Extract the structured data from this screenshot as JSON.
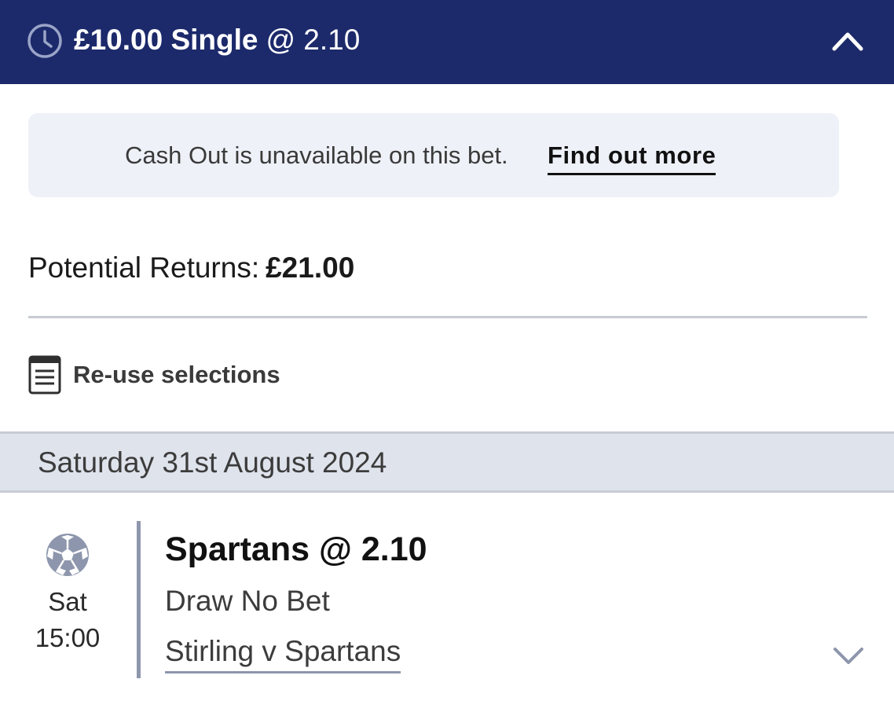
{
  "header": {
    "stake_label": "£10.00 Single",
    "odds_label": "@ 2.10",
    "icon": "clock-icon",
    "collapse_icon": "chevron-up-icon",
    "background_color": "#1c2a6b"
  },
  "cash_out_notice": {
    "message": "Cash Out is unavailable on this bet.",
    "link_label": "Find out more"
  },
  "returns": {
    "label": "Potential Returns:",
    "amount": "£21.00"
  },
  "reuse": {
    "label": "Re-use selections",
    "icon": "document-icon"
  },
  "date_header": "Saturday 31st August 2024",
  "selection": {
    "sport_icon": "football-icon",
    "day": "Sat",
    "time": "15:00",
    "name": "Spartans @ 2.10",
    "market": "Draw No Bet",
    "event": "Stirling v Spartans",
    "expand_icon": "chevron-down-icon"
  }
}
